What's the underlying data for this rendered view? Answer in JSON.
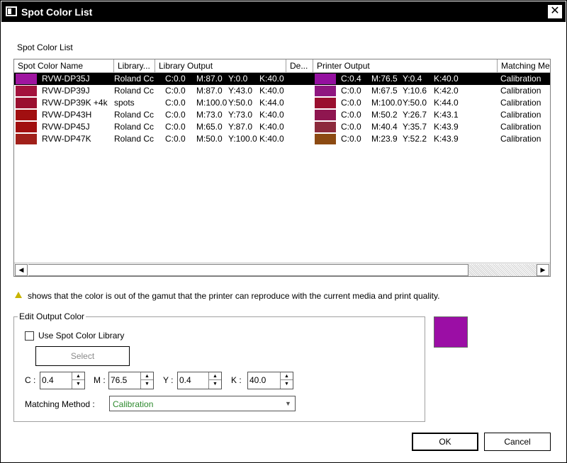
{
  "window": {
    "title": "Spot Color List",
    "close_glyph": "✕"
  },
  "list_section_label": "Spot Color List",
  "columns": [
    "Spot Color Name",
    "Library...",
    "Library Output",
    "De...",
    "Printer Output",
    "Matching Me"
  ],
  "rows": [
    {
      "name": "RVW-DP35J",
      "library": "Roland Cc",
      "lib_out": [
        "C:0.0",
        "M:87.0",
        "Y:0.0",
        "K:40.0"
      ],
      "prn_out": [
        "C:0.4",
        "M:76.5",
        "Y:0.4",
        "K:40.0"
      ],
      "method": "Calibration",
      "lib_color": "#9f15a0",
      "prn_color": "#940f9f",
      "selected": true
    },
    {
      "name": "RVW-DP39J",
      "library": "Roland Cc",
      "lib_out": [
        "C:0.0",
        "M:87.0",
        "Y:43.0",
        "K:40.0"
      ],
      "prn_out": [
        "C:0.0",
        "M:67.5",
        "Y:10.6",
        "K:42.0"
      ],
      "method": "Calibration",
      "lib_color": "#a3123d",
      "prn_color": "#8f1680",
      "selected": false
    },
    {
      "name": "RVW-DP39K +4k",
      "library": "spots",
      "lib_out": [
        "C:0.0",
        "M:100.0",
        "Y:50.0",
        "K:44.0"
      ],
      "prn_out": [
        "C:0.0",
        "M:100.0",
        "Y:50.0",
        "K:44.0"
      ],
      "method": "Calibration",
      "lib_color": "#9a0f2f",
      "prn_color": "#9a0f2f",
      "selected": false
    },
    {
      "name": "RVW-DP43H",
      "library": "Roland Cc",
      "lib_out": [
        "C:0.0",
        "M:73.0",
        "Y:73.0",
        "K:40.0"
      ],
      "prn_out": [
        "C:0.0",
        "M:50.2",
        "Y:26.7",
        "K:43.1"
      ],
      "method": "Calibration",
      "lib_color": "#a10f10",
      "prn_color": "#8f1650",
      "selected": false
    },
    {
      "name": "RVW-DP45J",
      "library": "Roland Cc",
      "lib_out": [
        "C:0.0",
        "M:65.0",
        "Y:87.0",
        "K:40.0"
      ],
      "prn_out": [
        "C:0.0",
        "M:40.4",
        "Y:35.7",
        "K:43.9"
      ],
      "method": "Calibration",
      "lib_color": "#a10f0f",
      "prn_color": "#8c2a3c",
      "selected": false
    },
    {
      "name": "RVW-DP47K",
      "library": "Roland Cc",
      "lib_out": [
        "C:0.0",
        "M:50.0",
        "Y:100.0",
        "K:40.0"
      ],
      "prn_out": [
        "C:0.0",
        "M:23.9",
        "Y:52.2",
        "K:43.9"
      ],
      "method": "Calibration",
      "lib_color": "#a1201a",
      "prn_color": "#8c4a12",
      "selected": false
    }
  ],
  "gamut_note": "shows that the color is out of the gamut that the printer can reproduce with the current media and print quality.",
  "edit": {
    "group_title": "Edit Output Color",
    "use_library_label": "Use Spot Color Library",
    "use_library_checked": false,
    "select_label": "Select",
    "c_label": "C :",
    "m_label": "M :",
    "y_label": "Y :",
    "k_label": "K :",
    "c_value": "0.4",
    "m_value": "76.5",
    "y_value": "0.4",
    "k_value": "40.0",
    "matching_label": "Matching Method :",
    "matching_value": "Calibration",
    "preview_color": "#9b0ea5"
  },
  "buttons": {
    "ok": "OK",
    "cancel": "Cancel"
  },
  "icons": {
    "warning": "warning-triangle-icon",
    "close": "close-icon",
    "app": "app-window-icon"
  }
}
